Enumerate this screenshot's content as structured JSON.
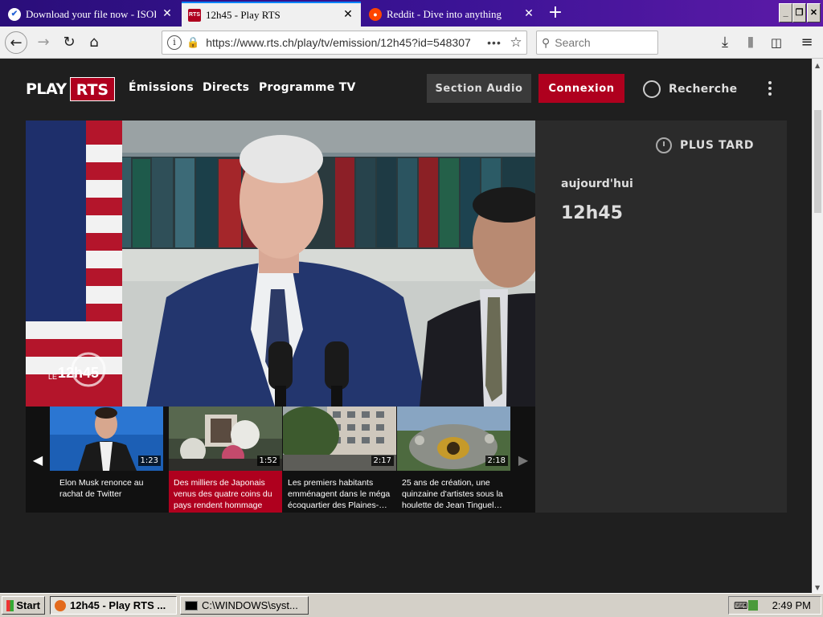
{
  "browser": {
    "tabs": [
      {
        "title": "Download your file now - ISOR",
        "active": false
      },
      {
        "title": "12h45 - Play RTS",
        "active": true
      },
      {
        "title": "Reddit - Dive into anything",
        "active": false
      }
    ],
    "new_tab_icon": "plus-icon",
    "url": "https://www.rts.ch/play/tv/emission/12h45?id=548307",
    "search_placeholder": "Search"
  },
  "site": {
    "logo_play": "PLAY",
    "logo_rts": "RTS",
    "nav": [
      "Émissions",
      "Directs",
      "Programme TV"
    ],
    "section_audio": "Section Audio",
    "login": "Connexion",
    "search": "Recherche"
  },
  "panel": {
    "later": "PLUS TARD",
    "date": "aujourd'hui",
    "title": "12h45"
  },
  "video": {
    "logo_le": "LE",
    "logo_num": "12h45"
  },
  "carousel": [
    {
      "caption": "Elon Musk renonce au rachat de Twitter",
      "duration": "1:23"
    },
    {
      "caption": "Des milliers de Japonais venus des quatre coins du pays rendent hommage à…",
      "duration": "1:52"
    },
    {
      "caption": "Les premiers habitants emménagent dans le méga écoquartier des Plaines-…",
      "duration": "2:17"
    },
    {
      "caption": "25 ans de création, une quinzaine d'artistes sous la houlette de Jean Tinguel…",
      "duration": "2:18"
    }
  ],
  "taskbar": {
    "start": "Start",
    "tasks": [
      "12h45 - Play RTS ...",
      "C:\\WINDOWS\\syst..."
    ],
    "clock": "2:49 PM"
  },
  "colors": {
    "accent": "#af001e",
    "tab_bar": "#3b1395",
    "page_bg": "#1f1f1f"
  }
}
